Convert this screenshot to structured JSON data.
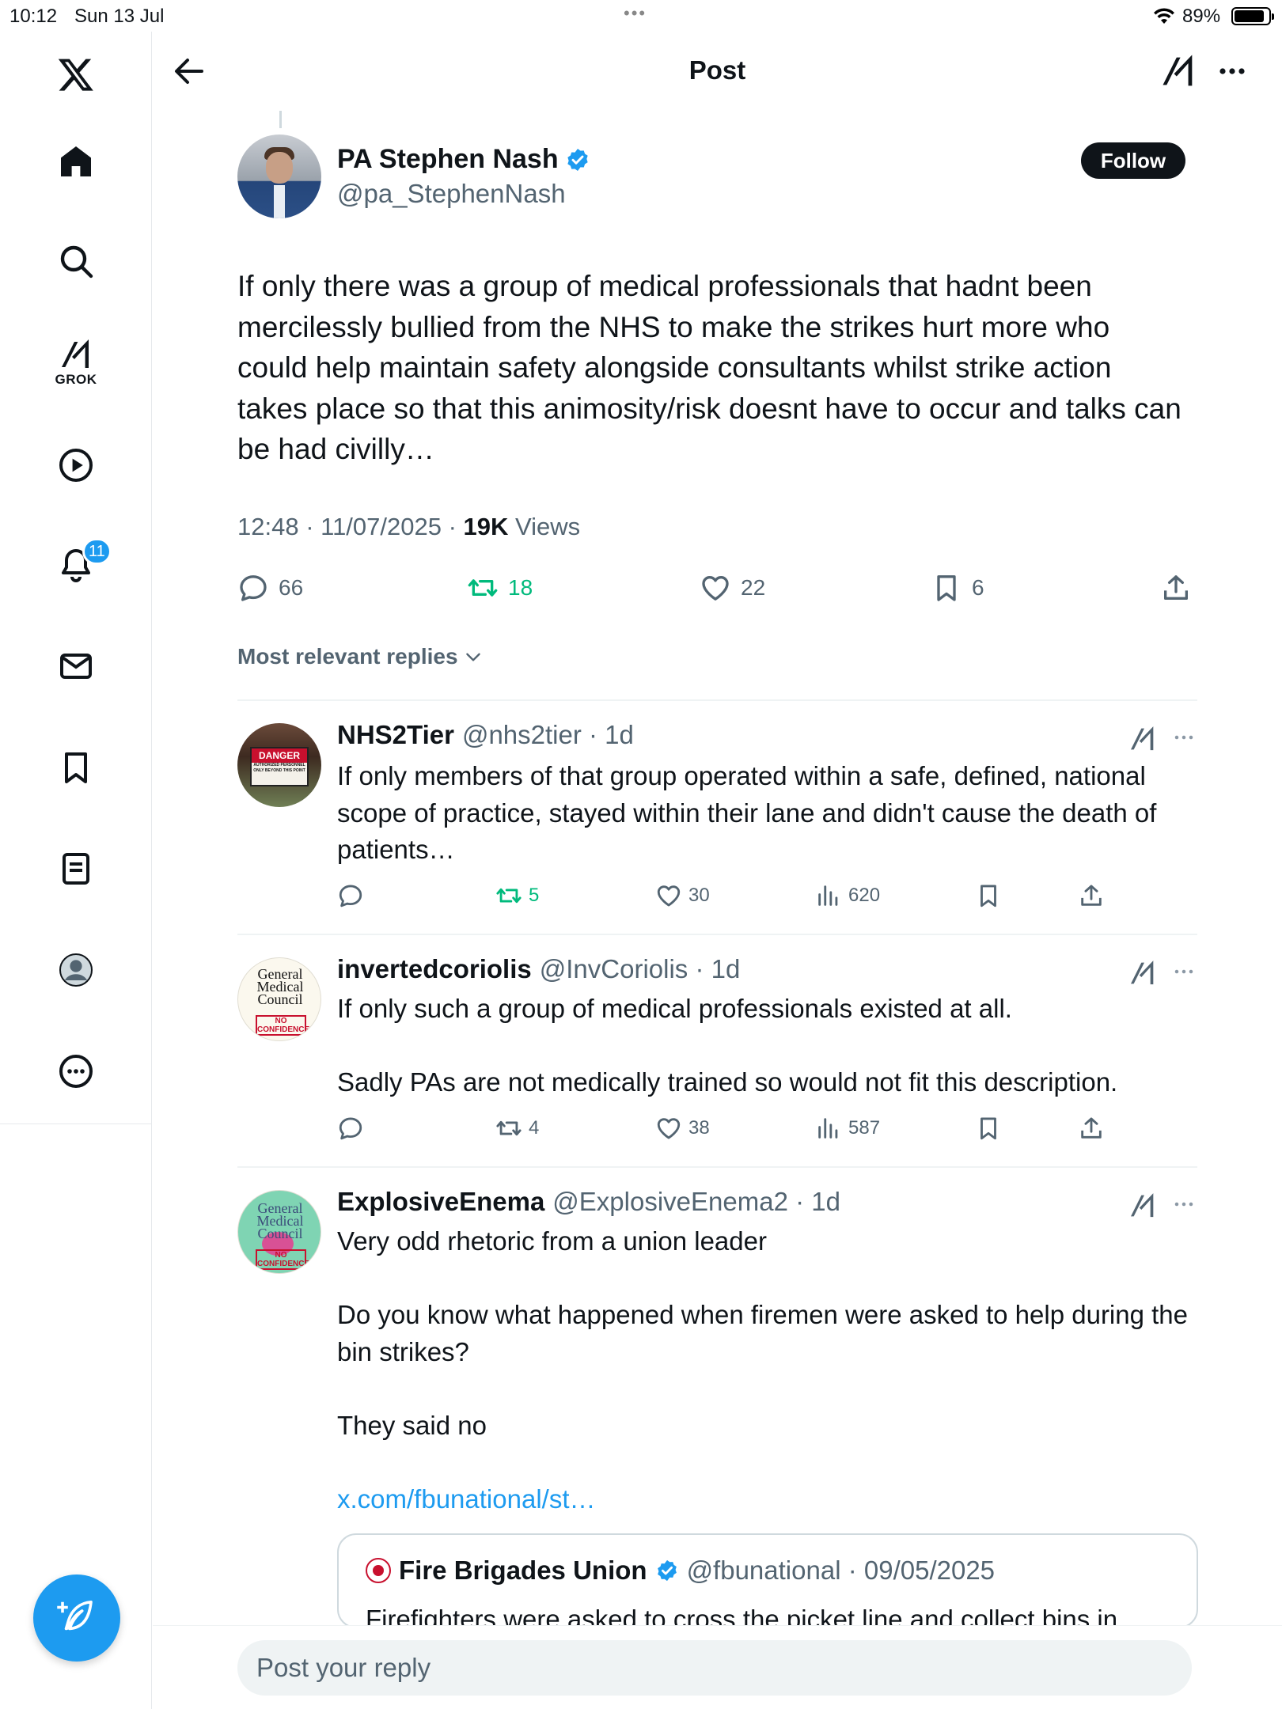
{
  "status_bar": {
    "time": "10:12",
    "date": "Sun 13 Jul",
    "battery": "89%"
  },
  "sidebar": {
    "items": [
      {
        "name": "home",
        "icon": "home-icon"
      },
      {
        "name": "explore",
        "icon": "search-icon"
      },
      {
        "name": "grok",
        "icon": "grok-icon",
        "label": "GROK"
      },
      {
        "name": "video",
        "icon": "play-icon"
      },
      {
        "name": "notifications",
        "icon": "bell-icon",
        "badge": "11"
      },
      {
        "name": "messages",
        "icon": "mail-icon"
      },
      {
        "name": "bookmarks",
        "icon": "bookmark-icon"
      },
      {
        "name": "lists",
        "icon": "list-icon"
      },
      {
        "name": "profile",
        "icon": "profile-icon"
      },
      {
        "name": "more",
        "icon": "more-circle-icon"
      }
    ],
    "compose_icon": "compose-icon"
  },
  "header": {
    "title": "Post"
  },
  "post": {
    "author_name": "PA Stephen Nash",
    "author_handle": "@pa_StephenNash",
    "follow_label": "Follow",
    "text": "If only there was a group of medical professionals that hadnt been mercilessly bullied from the NHS to make the strikes hurt more who could help maintain safety alongside consultants whilst strike action takes place so that this animosity/risk doesnt have to occur and talks can be had civilly…",
    "time": "12:48 · 11/07/2025 · ",
    "views_count": "19K",
    "views_label": " Views",
    "replies": "66",
    "reposts": "18",
    "likes": "22",
    "bookmarks": "6"
  },
  "sort": {
    "label": "Most relevant replies"
  },
  "replies": [
    {
      "name": "NHS2Tier",
      "handle": "@nhs2tier · 1d",
      "avatar_text": {
        "top": "DANGER",
        "sub": "AUTHORIZED PERSONNEL ONLY BEYOND THIS POINT"
      },
      "text": "If only members of that group operated within a safe, defined, national scope of practice, stayed within their lane and didn't cause the death of patients…",
      "reposts": "5",
      "likes": "30",
      "views": "620"
    },
    {
      "name": "invertedcoriolis",
      "handle": "@InvCoriolis · 1d",
      "avatar_text": {
        "l1": "General",
        "l2": "Medical",
        "l3": "Council",
        "stamp": "NO CONFIDENCE"
      },
      "text_1": "If only such a group of medical professionals existed at all.",
      "text_2": "Sadly PAs are not medically trained so would not fit this description.",
      "reposts": "4",
      "likes": "38",
      "views": "587"
    },
    {
      "name": "ExplosiveEnema",
      "handle": "@ExplosiveEnema2 · 1d",
      "avatar_text": {
        "l1": "General",
        "l2": "Medical",
        "l3": "Council",
        "stamp": "NO CONFIDENCE"
      },
      "text_1": "Very odd rhetoric from a union leader",
      "text_2": "Do you know what happened when firemen were asked to help during the bin strikes?",
      "text_3": "They said no",
      "link": "x.com/fbunational/st…",
      "quote": {
        "name": "Fire Brigades Union",
        "handle": "@fbunational · 09/05/2025",
        "text": "Firefighters were asked to cross the picket line and collect bins in"
      }
    }
  ],
  "reply_bar": {
    "placeholder": "Post your reply"
  },
  "colors": {
    "accent": "#1d9bf0",
    "repost_active": "#00ba7c",
    "text": "#0f1419",
    "secondary": "#536471"
  }
}
